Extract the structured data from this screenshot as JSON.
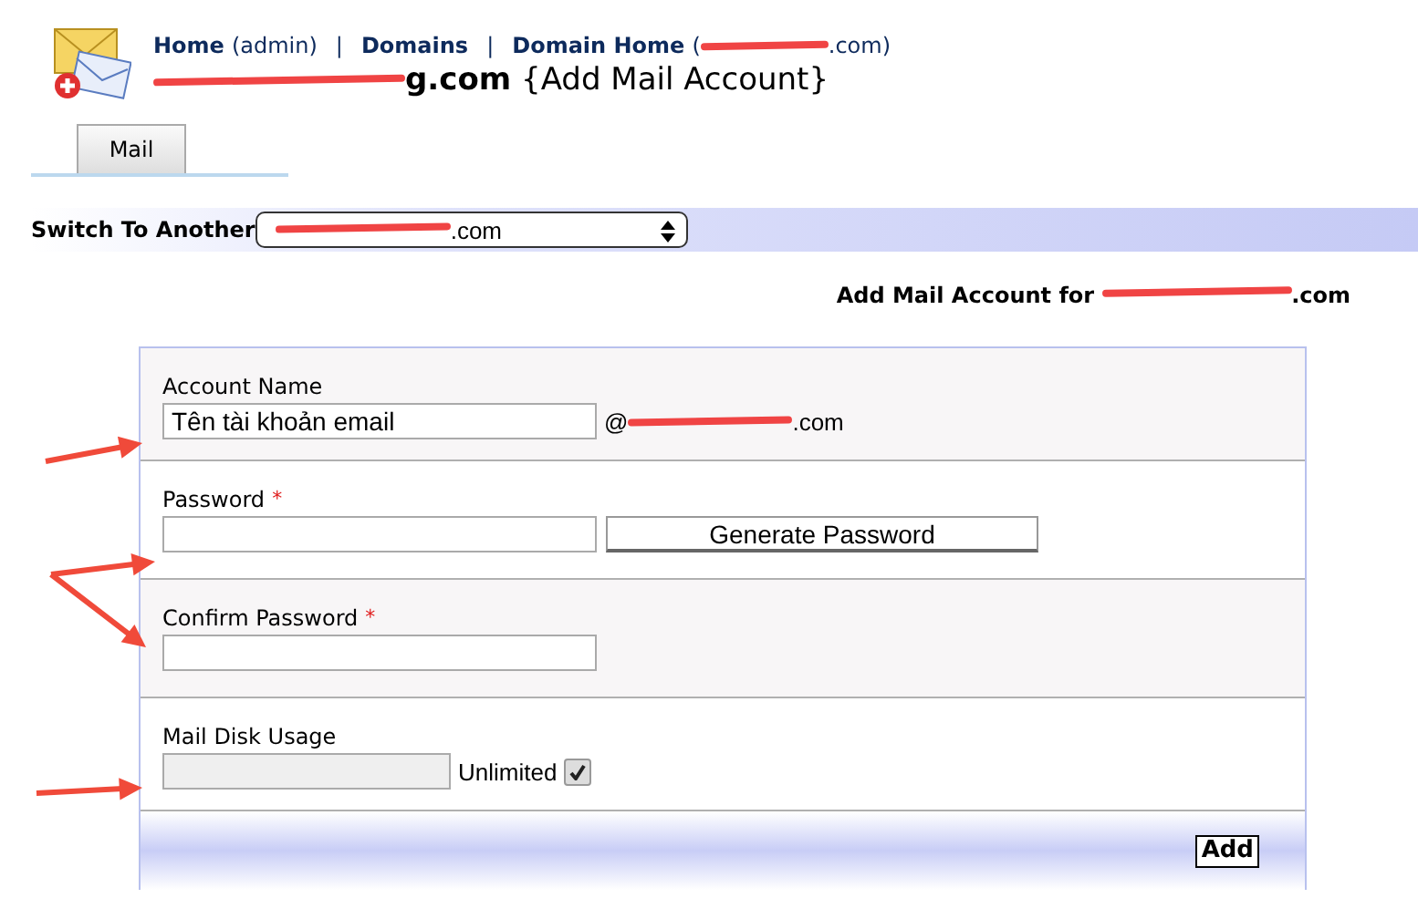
{
  "breadcrumbs": [
    {
      "label": "Home",
      "note": "(admin)",
      "separator": "|"
    },
    {
      "label": "Domains",
      "separator": "|"
    },
    {
      "label": "Domain Home",
      "note": "(",
      "domain": {
        "text": ".com)",
        "redacted": true
      }
    }
  ],
  "title": {
    "domain": {
      "text": "g.com",
      "redacted": true
    },
    "action": "{Add Mail Account}"
  },
  "tabs": [
    {
      "label": "Mail",
      "selected": true
    }
  ],
  "switch_bar": {
    "label": "Switch To Another",
    "select": {
      "text": ".com",
      "redacted": true
    }
  },
  "form_heading": {
    "text": "Add Mail Account for",
    "domain": {
      "text": ".com",
      "redacted": true
    }
  },
  "form": {
    "rows": [
      {
        "kind": "text",
        "label": "Account Name",
        "arrow": true,
        "value": "Tên tài khoản email",
        "suffix": {
          "text": "@",
          "tail": ".com",
          "redacted": true
        }
      },
      {
        "kind": "password",
        "label": "Password",
        "required_mark": "*",
        "arrow": true,
        "button": "Generate Password"
      },
      {
        "kind": "password",
        "label": "Confirm Password",
        "required_mark": "*",
        "arrow": true
      },
      {
        "kind": "quota",
        "label": "Mail Disk Usage",
        "arrow": true,
        "checkbox": {
          "label": "Unlimited",
          "checked": true
        }
      }
    ],
    "submit": "Add"
  }
}
